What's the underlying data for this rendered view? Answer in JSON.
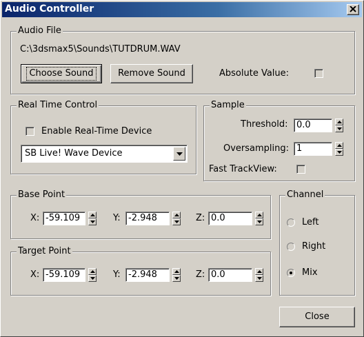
{
  "window": {
    "title": "Audio Controller",
    "close_glyph": "✕"
  },
  "audio_file": {
    "legend": "Audio File",
    "path": "C:\\3dsmax5\\Sounds\\TUTDRUM.WAV",
    "choose_label": "Choose Sound",
    "remove_label": "Remove Sound",
    "absolute_label": "Absolute Value:",
    "absolute_checked": false
  },
  "real_time": {
    "legend": "Real Time Control",
    "enable_label": "Enable Real-Time Device",
    "enable_checked": false,
    "device": "SB Live! Wave Device"
  },
  "sample": {
    "legend": "Sample",
    "threshold_label": "Threshold:",
    "threshold_value": "0.0",
    "oversampling_label": "Oversampling:",
    "oversampling_value": "1",
    "fast_trackview_label": "Fast TrackView:",
    "fast_trackview_checked": false
  },
  "base_point": {
    "legend": "Base Point",
    "x_label": "X:",
    "x_value": "-59.109",
    "y_label": "Y:",
    "y_value": "-2.948",
    "z_label": "Z:",
    "z_value": "0.0"
  },
  "target_point": {
    "legend": "Target Point",
    "x_label": "X:",
    "x_value": "-59.109",
    "y_label": "Y:",
    "y_value": "-2.948",
    "z_label": "Z:",
    "z_value": "0.0"
  },
  "channel": {
    "legend": "Channel",
    "options": [
      "Left",
      "Right",
      "Mix"
    ],
    "selected": "Mix"
  },
  "close_label": "Close",
  "icons": {
    "close": "close-icon",
    "dropdown": "dropdown-arrow-icon",
    "spin_up": "spinner-up-icon",
    "spin_down": "spinner-down-icon"
  }
}
